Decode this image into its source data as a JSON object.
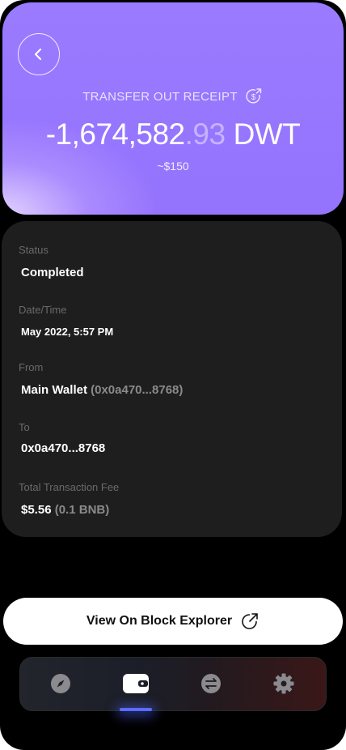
{
  "header": {
    "title": "TRANSFER OUT RECEIPT",
    "amount_main": "-1,674,582",
    "amount_decimals": ".93",
    "amount_unit": "DWT",
    "fiat_value": "~$150",
    "icons": {
      "back": "chevron-left-icon",
      "title_icon": "dollar-send-icon"
    }
  },
  "details": {
    "status_label": "Status",
    "status_value": "Completed",
    "datetime_label": "Date/Time",
    "datetime_value": "May 2022, 5:57 PM",
    "from_label": "From",
    "from_name": "Main Wallet",
    "from_address": "(0x0a470...8768)",
    "to_label": "To",
    "to_address": "0x0a470...8768",
    "fee_label": "Total Transaction Fee",
    "fee_fiat": "$5.56",
    "fee_crypto": "(0.1 BNB)"
  },
  "explorer_button": {
    "label": "View On Block Explorer",
    "icon": "external-link-icon"
  },
  "tabbar": {
    "tabs": [
      {
        "name": "explore",
        "icon": "compass-icon",
        "active": false
      },
      {
        "name": "wallet",
        "icon": "wallet-icon",
        "active": true
      },
      {
        "name": "swap",
        "icon": "swap-icon",
        "active": false
      },
      {
        "name": "settings",
        "icon": "gear-icon",
        "active": false
      }
    ],
    "accent_color": "#5b6cff"
  },
  "colors": {
    "header_purple": "#9473fd",
    "card_bg": "#1e1e1e",
    "background": "#000000"
  }
}
